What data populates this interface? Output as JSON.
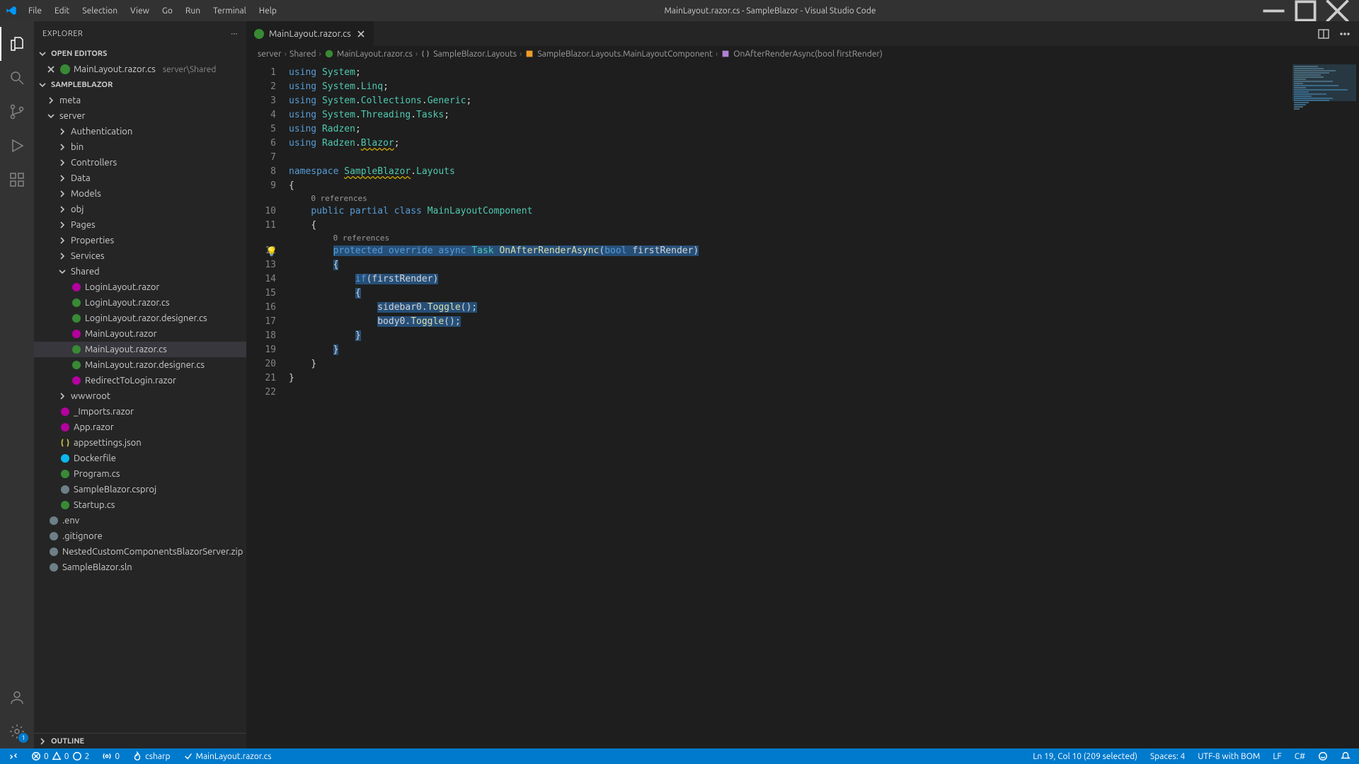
{
  "window": {
    "title": "MainLayout.razor.cs - SampleBlazor - Visual Studio Code"
  },
  "menubar": [
    "File",
    "Edit",
    "Selection",
    "View",
    "Go",
    "Run",
    "Terminal",
    "Help"
  ],
  "activitybar": {
    "gear_badge": "1"
  },
  "explorer": {
    "title": "EXPLORER",
    "open_editors_label": "OPEN EDITORS",
    "project_label": "SAMPLEBLAZOR",
    "outline_label": "OUTLINE",
    "open_editors": [
      {
        "name": "MainLayout.razor.cs",
        "annot": "server\\Shared"
      }
    ],
    "tree": {
      "root": "SAMPLEBLAZOR",
      "folders_top": [
        {
          "name": "meta",
          "depth": 1,
          "expanded": false
        }
      ],
      "server": {
        "name": "server",
        "children": [
          {
            "name": "Authentication",
            "type": "folder"
          },
          {
            "name": "bin",
            "type": "folder"
          },
          {
            "name": "Controllers",
            "type": "folder"
          },
          {
            "name": "Data",
            "type": "folder"
          },
          {
            "name": "Models",
            "type": "folder"
          },
          {
            "name": "obj",
            "type": "folder"
          },
          {
            "name": "Pages",
            "type": "folder"
          },
          {
            "name": "Properties",
            "type": "folder"
          },
          {
            "name": "Services",
            "type": "folder"
          }
        ],
        "shared": {
          "name": "Shared",
          "files": [
            {
              "name": "LoginLayout.razor",
              "icon": "razor"
            },
            {
              "name": "LoginLayout.razor.cs",
              "icon": "cs"
            },
            {
              "name": "LoginLayout.razor.designer.cs",
              "icon": "cs"
            },
            {
              "name": "MainLayout.razor",
              "icon": "razor"
            },
            {
              "name": "MainLayout.razor.cs",
              "icon": "cs",
              "active": true
            },
            {
              "name": "MainLayout.razor.designer.cs",
              "icon": "cs"
            },
            {
              "name": "RedirectToLogin.razor",
              "icon": "razor"
            }
          ]
        },
        "rest": [
          {
            "name": "wwwroot",
            "type": "folder"
          },
          {
            "name": "_Imports.razor",
            "type": "razor"
          },
          {
            "name": "App.razor",
            "type": "razor"
          },
          {
            "name": "appsettings.json",
            "type": "json"
          },
          {
            "name": "Dockerfile",
            "type": "docker"
          },
          {
            "name": "Program.cs",
            "type": "cs"
          },
          {
            "name": "SampleBlazor.csproj",
            "type": "generic"
          },
          {
            "name": "Startup.cs",
            "type": "cs"
          }
        ]
      },
      "root_files": [
        {
          "name": ".env",
          "type": "gear"
        },
        {
          "name": ".gitignore",
          "type": "generic"
        },
        {
          "name": "NestedCustomComponentsBlazorServer.zip",
          "type": "generic"
        },
        {
          "name": "SampleBlazor.sln",
          "type": "generic"
        }
      ]
    }
  },
  "tabs": [
    {
      "name": "MainLayout.razor.cs",
      "icon": "cs"
    }
  ],
  "breadcrumb": [
    {
      "label": "server"
    },
    {
      "label": "Shared"
    },
    {
      "label": "MainLayout.razor.cs",
      "icon": "cs"
    },
    {
      "label": "SampleBlazor.Layouts",
      "icon": "ns"
    },
    {
      "label": "SampleBlazor.Layouts.MainLayoutComponent",
      "icon": "class"
    },
    {
      "label": "OnAfterRenderAsync(bool firstRender)",
      "icon": "method"
    }
  ],
  "codelens": {
    "class_refs": "0 references",
    "method_refs": "0 references"
  },
  "code_tokens": {
    "using": "using",
    "namespace": "namespace",
    "public": "public",
    "partial": "partial",
    "class": "class",
    "protected": "protected",
    "override": "override",
    "async": "async",
    "Task": "Task",
    "bool": "bool",
    "System": "System",
    "Linq": "Linq",
    "Collections": "Collections",
    "Generic": "Generic",
    "Threading": "Threading",
    "Tasks": "Tasks",
    "Radzen": "Radzen",
    "Blazor": "Blazor",
    "SampleBlazor": "SampleBlazor",
    "Layouts": "Layouts",
    "MainLayoutComponent": "MainLayoutComponent",
    "OnAfterRenderAsync": "OnAfterRenderAsync",
    "firstRender": "firstRender",
    "if": "if",
    "sidebar0": "sidebar0",
    "body0": "body0",
    "Toggle": "Toggle"
  },
  "statusbar": {
    "errors": "0",
    "warnings": "0",
    "info": "2",
    "port": "0",
    "lang_server": "csharp",
    "file": "MainLayout.razor.cs",
    "position": "Ln 19, Col 10 (209 selected)",
    "spaces": "Spaces: 4",
    "encoding": "UTF-8 with BOM",
    "eol": "LF",
    "language": "C#"
  }
}
